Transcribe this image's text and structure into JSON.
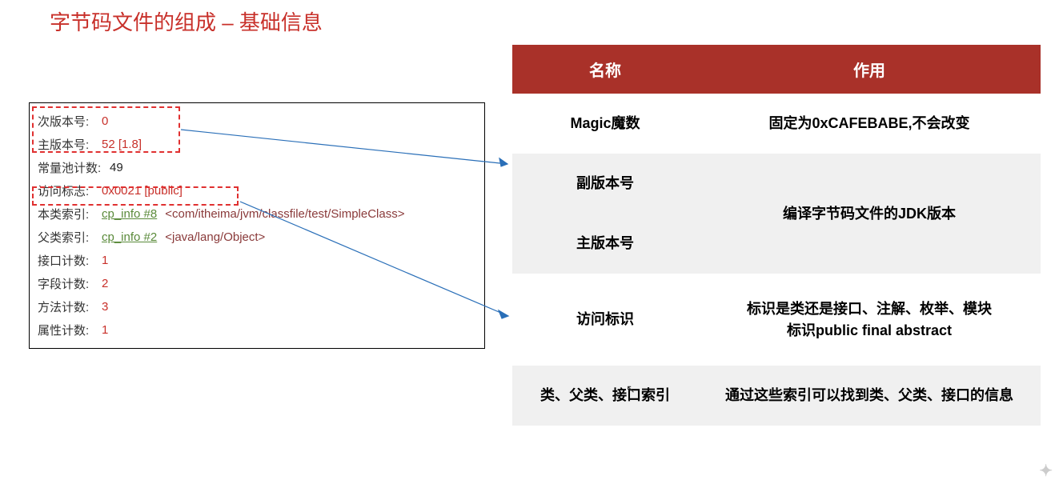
{
  "title": "字节码文件的组成 – 基础信息",
  "code": {
    "minor_label": "次版本号:",
    "minor_val": "0",
    "major_label": "主版本号:",
    "major_val": "52 [1.8]",
    "cp_count_label": "常量池计数:",
    "cp_count_val": "49",
    "access_label": "访问标志:",
    "access_val": "0x0021 [public]",
    "this_label": "本类索引:",
    "this_ref": "cp_info #8",
    "this_class": "<com/itheima/jvm/classfile/test/SimpleClass>",
    "super_label": "父类索引:",
    "super_ref": "cp_info #2",
    "super_class": "<java/lang/Object>",
    "iface_label": "接口计数:",
    "iface_val": "1",
    "field_label": "字段计数:",
    "field_val": "2",
    "method_label": "方法计数:",
    "method_val": "3",
    "attr_label": "属性计数:",
    "attr_val": "1"
  },
  "table": {
    "header_name": "名称",
    "header_desc": "作用",
    "rows": {
      "r0_name": "Magic魔数",
      "r0_desc": "固定为0xCAFEBABE,不会改变",
      "r1_name": "副版本号",
      "r2_name": "主版本号",
      "r12_desc": "编译字节码文件的JDK版本",
      "r3_name": "访问标识",
      "r3_desc": "标识是类还是接口、注解、枚举、模块\n标识public final abstract",
      "r4_name": "类、父类、接口索引",
      "r4_desc": "通过这些索引可以找到类、父类、接口的信息"
    }
  }
}
